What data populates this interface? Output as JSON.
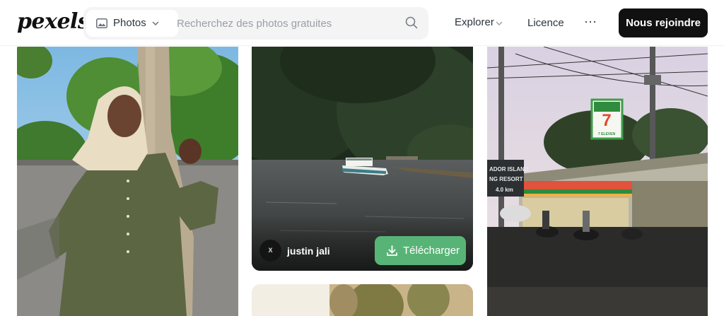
{
  "header": {
    "logo": "pexels",
    "search": {
      "type_label": "Photos",
      "placeholder": "Recherchez des photos gratuites"
    },
    "nav": {
      "explore": "Explorer",
      "licence": "Licence",
      "more": "···"
    },
    "join_button": "Nous rejoindre"
  },
  "photos": {
    "card2": {
      "author_initial": "X",
      "author_name": "justin jali",
      "download_label": "Télécharger"
    },
    "card4": {
      "sign_store": "7 ELEVEN",
      "sign_street": "ADOR ISLAND",
      "sign_resort": "NG RESORT",
      "sign_distance": "4.0 km"
    }
  },
  "colors": {
    "accent_download": "#58b476",
    "join_button_bg": "#111111"
  }
}
